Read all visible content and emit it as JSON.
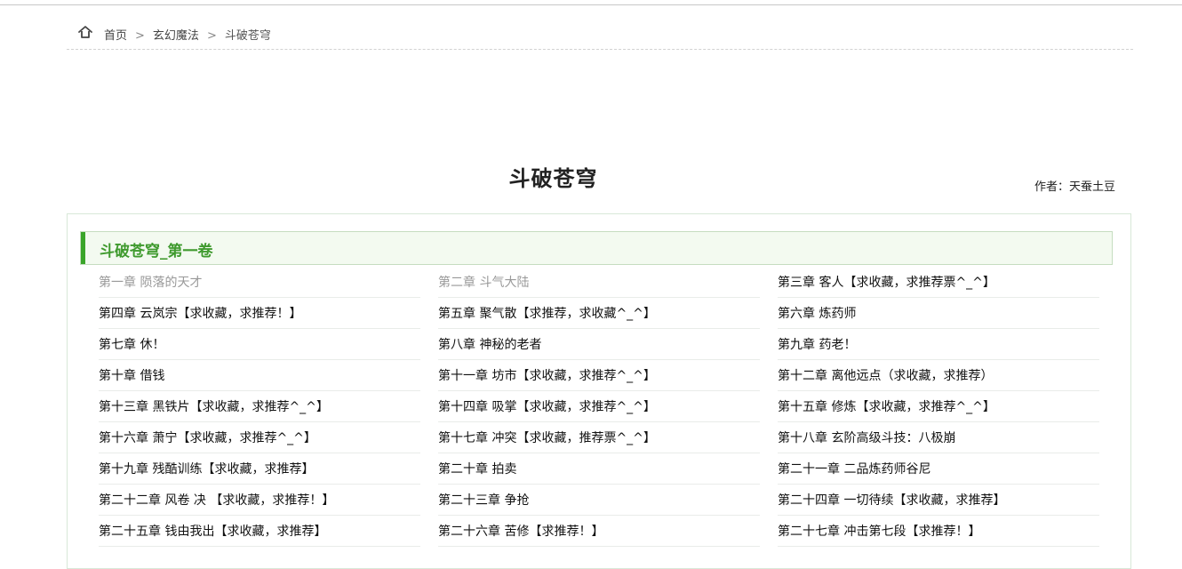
{
  "breadcrumb": {
    "home_label": "首页",
    "category_label": "玄幻魔法",
    "current_label": "斗破苍穹",
    "separator": ">"
  },
  "book": {
    "title": "斗破苍穹",
    "author": "作者：天蚕土豆"
  },
  "volume": {
    "title": "斗破苍穹_第一卷"
  },
  "chapters": [
    {
      "label": "第一章 陨落的天才",
      "visited": true
    },
    {
      "label": "第二章 斗气大陆",
      "visited": true
    },
    {
      "label": "第三章 客人【求收藏，求推荐票^_^】",
      "visited": false
    },
    {
      "label": "第四章 云岚宗【求收藏，求推荐！】",
      "visited": false
    },
    {
      "label": "第五章 聚气散【求推荐，求收藏^_^】",
      "visited": false
    },
    {
      "label": "第六章 炼药师",
      "visited": false
    },
    {
      "label": "第七章 休！",
      "visited": false
    },
    {
      "label": "第八章 神秘的老者",
      "visited": false
    },
    {
      "label": "第九章 药老！",
      "visited": false
    },
    {
      "label": "第十章 借钱",
      "visited": false
    },
    {
      "label": "第十一章 坊市【求收藏，求推荐^_^】",
      "visited": false
    },
    {
      "label": "第十二章 离他远点（求收藏，求推荐）",
      "visited": false
    },
    {
      "label": "第十三章 黑铁片【求收藏，求推荐^_^】",
      "visited": false
    },
    {
      "label": "第十四章 吸掌【求收藏，求推荐^_^】",
      "visited": false
    },
    {
      "label": "第十五章 修炼【求收藏，求推荐^_^】",
      "visited": false
    },
    {
      "label": "第十六章 萧宁【求收藏，求推荐^_^】",
      "visited": false
    },
    {
      "label": "第十七章 冲突【求收藏，推荐票^_^】",
      "visited": false
    },
    {
      "label": "第十八章 玄阶高级斗技：八极崩",
      "visited": false
    },
    {
      "label": "第十九章 残酷训练【求收藏，求推荐】",
      "visited": false
    },
    {
      "label": "第二十章 拍卖",
      "visited": false
    },
    {
      "label": "第二十一章 二品炼药师谷尼",
      "visited": false
    },
    {
      "label": "第二十二章 风卷 决 【求收藏，求推荐！】",
      "visited": false
    },
    {
      "label": "第二十三章 争抢",
      "visited": false
    },
    {
      "label": "第二十四章 一切待续【求收藏，求推荐】",
      "visited": false
    },
    {
      "label": "第二十五章 钱由我出【求收藏，求推荐】",
      "visited": false
    },
    {
      "label": "第二十六章 苦修【求推荐！】",
      "visited": false
    },
    {
      "label": "第二十七章 冲击第七段【求推荐！】",
      "visited": false
    }
  ],
  "colors": {
    "accent_green": "#3aa52a",
    "volume_title_green": "#3f9a2e",
    "visited_link": "#999999"
  },
  "icons": {
    "home": "home-icon"
  }
}
